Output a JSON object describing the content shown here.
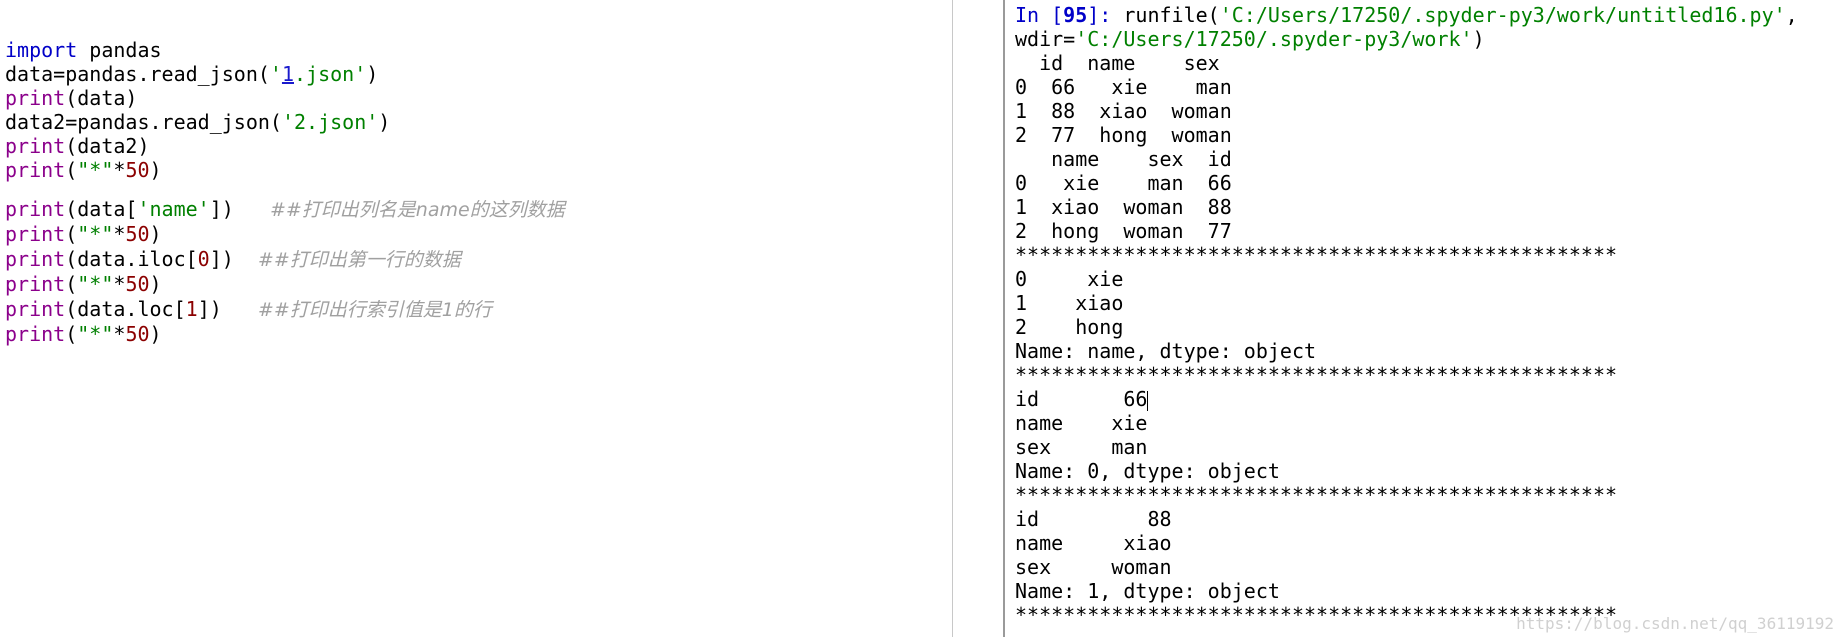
{
  "editor": {
    "lines": [
      {
        "a": "import",
        "b": " pandas"
      },
      {
        "a": "data=pandas.read_json(",
        "s1": "'",
        "n": "1",
        "s2": ".json'",
        "e": ")"
      },
      {
        "bi": "print",
        "rest": "(data)"
      },
      {
        "a": "data2=pandas.read_json(",
        "s": "'2.json'",
        "e": ")"
      },
      {
        "bi": "print",
        "rest": "(data2)"
      },
      {
        "bi": "print",
        "p1": "(",
        "s": "\"*\"",
        "p2": "*",
        "n": "50",
        "p3": ")"
      },
      {
        "bi": "print",
        "p1": "(data[",
        "s": "'name'",
        "p2": "])",
        "c": "##打印出列名是name的这列数据"
      },
      {
        "bi": "print",
        "p1": "(",
        "s": "\"*\"",
        "p2": "*",
        "n": "50",
        "p3": ")"
      },
      {
        "bi": "print",
        "p1": "(data.iloc[",
        "n": "0",
        "p2": "])",
        "c": "##打印出第一行的数据"
      },
      {
        "bi": "print",
        "p1": "(",
        "s": "\"*\"",
        "p2": "*",
        "n": "50",
        "p3": ")"
      },
      {
        "bi": "print",
        "p1": "(data.loc[",
        "n": "1",
        "p2": "])",
        "c": "##打印出行索引值是1的行"
      },
      {
        "bi": "print",
        "p1": "(",
        "s": "\"*\"",
        "p2": "*",
        "n": "50",
        "p3": ")"
      }
    ]
  },
  "console": {
    "prompt_in": "In [",
    "prompt_num": "95",
    "prompt_close": "]: ",
    "run_call": "runfile(",
    "run_path": "'C:/Users/17250/.spyder-py3/work/untitled16.py'",
    "run_sep": ",",
    "wdir_key": "wdir=",
    "wdir_val": "'C:/Users/17250/.spyder-py3/work'",
    "wdir_close": ")",
    "output_lines": [
      "  id  name    sex",
      "0  66   xie    man",
      "1  88  xiao  woman",
      "2  77  hong  woman",
      "   name    sex  id",
      "0   xie    man  66",
      "1  xiao  woman  88",
      "2  hong  woman  77",
      "**************************************************",
      "0     xie",
      "1    xiao",
      "2    hong",
      "Name: name, dtype: object",
      "**************************************************",
      "id       66",
      "name    xie",
      "sex     man",
      "Name: 0, dtype: object",
      "**************************************************",
      "id         88",
      "name     xiao",
      "sex     woman",
      "Name: 1, dtype: object",
      "**************************************************"
    ],
    "watermark": "https://blog.csdn.net/qq_36119192"
  }
}
